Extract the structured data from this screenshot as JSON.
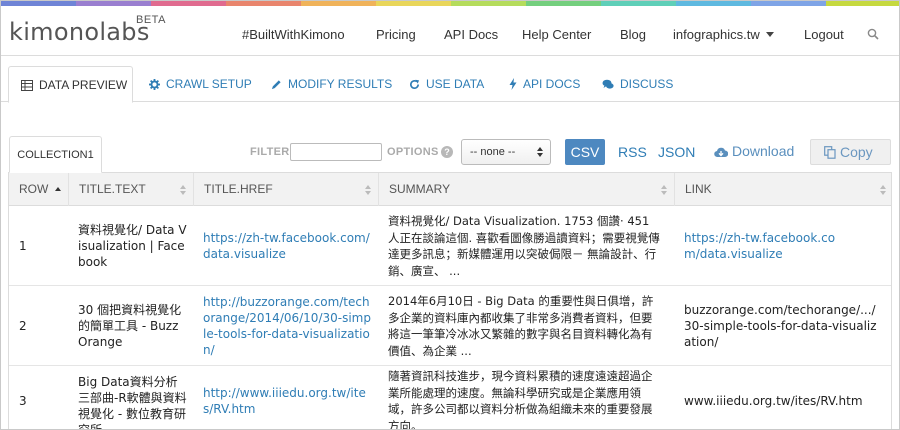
{
  "brand": {
    "name": "kimonolabs",
    "badge": "BETA"
  },
  "header": {
    "nav": [
      {
        "label": "#BuiltWithKimono",
        "name": "nav-built-with-kimono"
      },
      {
        "label": "Pricing",
        "name": "nav-pricing"
      },
      {
        "label": "API Docs",
        "name": "nav-api-docs"
      },
      {
        "label": "Help Center",
        "name": "nav-help-center"
      },
      {
        "label": "Blog",
        "name": "nav-blog"
      }
    ],
    "account": "infographics.tw",
    "logout": "Logout",
    "search_icon": "search-icon"
  },
  "rainbow": [
    "#6f84d6",
    "#9a7fd0",
    "#e06b8f",
    "#e9856d",
    "#f0b35a",
    "#e9d65a",
    "#b5dc5c",
    "#74cf7e",
    "#5fcfb8",
    "#5fb9e0",
    "#7fa4e6",
    "#c6d93f"
  ],
  "tabs": [
    {
      "label": "DATA PREVIEW",
      "icon": "table-icon",
      "active": true
    },
    {
      "label": "CRAWL SETUP",
      "icon": "gear-icon"
    },
    {
      "label": "MODIFY RESULTS",
      "icon": "pencil-icon"
    },
    {
      "label": "USE DATA",
      "icon": "refresh-icon"
    },
    {
      "label": "API DOCS",
      "icon": "bolt-icon"
    },
    {
      "label": "DISCUSS",
      "icon": "chat-icon"
    }
  ],
  "collection": {
    "tab_label": "COLLECTION1"
  },
  "toolbar": {
    "filter_label": "FILTER",
    "filter_value": "",
    "options_label": "OPTIONS",
    "select_value": "-- none --",
    "formats": [
      "CSV",
      "RSS",
      "JSON"
    ],
    "active_format": "CSV",
    "download_label": "Download",
    "copy_label": "Copy"
  },
  "table": {
    "columns": [
      "ROW",
      "TITLE.TEXT",
      "TITLE.HREF",
      "SUMMARY",
      "LINK"
    ],
    "rows": [
      {
        "row": "1",
        "title_text": "資料視覺化/ Data Visualization | Facebook",
        "title_href": "https://zh-tw.facebook.com/data.visualize",
        "summary": "資料視覺化/ Data Visualization. 1753 個讚· 451 人正在談論這個. 喜歡看圖像勝過讀資料；需要視覺傳達更多訊息；新媒體運用以突破侷限－ 無論設計、行銷、廣宣、 ...",
        "link": "https://zh-tw.facebook.com/data.visualize"
      },
      {
        "row": "2",
        "title_text": "30 個把資料視覺化的簡單工具 - BuzzOrange",
        "title_href": "http://buzzorange.com/techorange/2014/06/10/30-simple-tools-for-data-visualization/",
        "summary": "2014年6月10日 - Big Data 的重要性與日俱增，許多企業的資料庫內都收集了非常多消費者資料，但要將這一筆筆冷冰冰又繁雜的數字與名目資料轉化為有價值、為企業 ...",
        "link": "buzzorange.com/techorange/.../30-simple-tools-for-data-visualization/"
      },
      {
        "row": "3",
        "title_text": "Big Data資料分析三部曲-R軟體與資料視覺化 - 數位教育研究所",
        "title_href": "http://www.iiiedu.org.tw/ites/RV.htm",
        "summary": "隨著資訊科技進步，現今資料累積的速度遠遠超過企業所能處理的速度。無論科學研究或是企業應用領域，許多公司都以資料分析做為組織未來的重要發展方向。",
        "link": "www.iiiedu.org.tw/ites/RV.htm"
      }
    ]
  }
}
